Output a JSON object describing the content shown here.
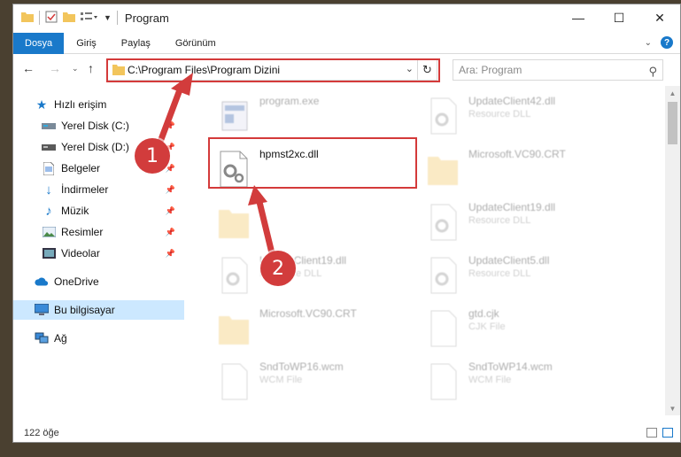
{
  "window": {
    "title": "Program",
    "controls": {
      "minimize": "—",
      "maximize": "☐",
      "close": "✕"
    }
  },
  "ribbon": {
    "tabs": [
      {
        "label": "Dosya",
        "active": true
      },
      {
        "label": "Giriş"
      },
      {
        "label": "Paylaş"
      },
      {
        "label": "Görünüm"
      }
    ]
  },
  "nav": {
    "address": "C:\\Program Files\\Program Dizini",
    "search_placeholder": "Ara: Program"
  },
  "sidebar": {
    "items": [
      {
        "label": "Hızlı erişim",
        "icon": "star-icon",
        "pinned": false
      },
      {
        "label": "Yerel Disk (C:)",
        "icon": "drive-icon",
        "pinned": true
      },
      {
        "label": "Yerel Disk (D:)",
        "icon": "drive-icon",
        "pinned": true
      },
      {
        "label": "Belgeler",
        "icon": "document-icon",
        "pinned": true
      },
      {
        "label": "İndirmeler",
        "icon": "download-icon",
        "pinned": true
      },
      {
        "label": "Müzik",
        "icon": "music-icon",
        "pinned": true
      },
      {
        "label": "Resimler",
        "icon": "picture-icon",
        "pinned": true
      },
      {
        "label": "Videolar",
        "icon": "video-icon",
        "pinned": true
      },
      {
        "label": "OneDrive",
        "icon": "cloud-icon",
        "pinned": false
      },
      {
        "label": "Bu bilgisayar",
        "icon": "computer-icon",
        "pinned": false,
        "selected": true
      },
      {
        "label": "Ağ",
        "icon": "network-icon",
        "pinned": false
      }
    ]
  },
  "files": [
    {
      "name": "program.exe",
      "type": "",
      "icon": "exe-icon",
      "faded": true
    },
    {
      "name": "UpdateClient42.dll",
      "type": "Resource DLL",
      "icon": "dll-icon",
      "faded": true
    },
    {
      "name": "hpmst2xc.dll",
      "type": "",
      "icon": "dll-icon",
      "faded": false
    },
    {
      "name": "Microsoft.VC90.CRT",
      "type": "",
      "icon": "folder-icon",
      "faded": true
    },
    {
      "name": "",
      "type": "",
      "icon": "folder-icon",
      "faded": true
    },
    {
      "name": "UpdateClient19.dll",
      "type": "Resource DLL",
      "icon": "dll-icon",
      "faded": true
    },
    {
      "name": "UpdateClient19.dll",
      "type": "Resource DLL",
      "icon": "dll-icon",
      "faded": true
    },
    {
      "name": "UpdateClient5.dll",
      "type": "Resource DLL",
      "icon": "dll-icon",
      "faded": true
    },
    {
      "name": "Microsoft.VC90.CRT",
      "type": "",
      "icon": "folder-icon",
      "faded": true
    },
    {
      "name": "gtd.cjk",
      "type": "CJK File",
      "icon": "file-icon",
      "faded": true
    },
    {
      "name": "SndToWP16.wcm",
      "type": "WCM File",
      "icon": "file-icon",
      "faded": true
    },
    {
      "name": "SndToWP14.wcm",
      "type": "WCM File",
      "icon": "file-icon",
      "faded": true
    }
  ],
  "status": {
    "count": "122 öğe"
  },
  "callouts": [
    "1",
    "2"
  ],
  "colors": {
    "accent": "#1979ca",
    "highlight": "#d43a3a",
    "selected": "#cce8ff"
  }
}
